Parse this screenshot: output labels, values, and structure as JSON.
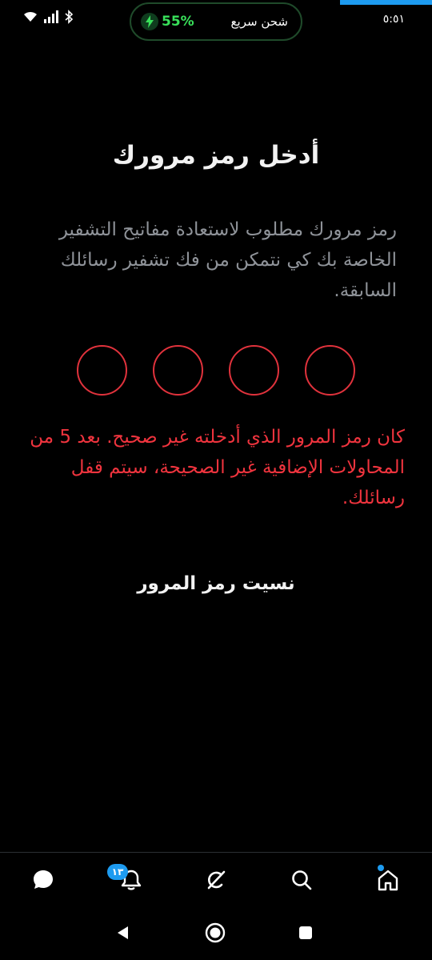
{
  "status_bar": {
    "time": "٥:٥١",
    "charge_percent": "55%",
    "charge_label": "شحن سريع"
  },
  "passcode": {
    "title": "أدخل رمز مرورك",
    "description": "رمز مرورك مطلوب لاستعادة مفاتيح التشفير الخاصة بك كي نتمكن من فك تشفير رسائلك السابقة.",
    "digit_count": 4,
    "error": "كان رمز المرور الذي أدخلته غير صحيح. بعد 5 من المحاولات الإضافية غير الصحيحة، سيتم قفل رسائلك.",
    "forgot_label": "نسيت رمز المرور"
  },
  "tab_bar": {
    "notifications_badge": "١٣",
    "items": [
      "messages-icon",
      "notifications-icon",
      "grok-icon",
      "search-icon",
      "home-icon"
    ]
  },
  "colors": {
    "accent": "#1d9bf0",
    "error": "#f0343e",
    "charge": "#39e05a"
  }
}
